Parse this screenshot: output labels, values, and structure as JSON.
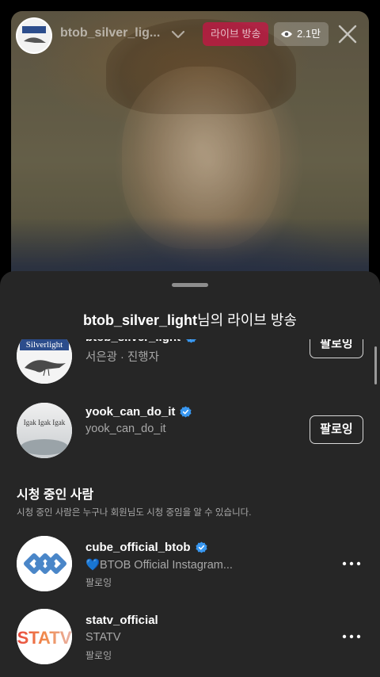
{
  "live": {
    "host_username": "btob_silver_lig...",
    "live_label": "라이브 방송",
    "viewer_count": "2.1만"
  },
  "sheet": {
    "title_bold": "btob_silver_light",
    "title_rest": "님의 라이브 방송",
    "hosts": [
      {
        "username": "btob_silver_light",
        "verified": true,
        "subtitle": "서은광 · 진행자",
        "button_label": "팔로잉",
        "avatar_text": "Silverlight"
      },
      {
        "username": "yook_can_do_it",
        "verified": true,
        "subtitle": "yook_can_do_it",
        "button_label": "팔로잉",
        "avatar_text": "Igak Igak Igak"
      }
    ],
    "viewers_section": {
      "title": "시청 중인 사람",
      "description": "시청 중인 사람은 누구나 회원님도 시청 중임을 알 수 있습니다."
    },
    "viewers": [
      {
        "username": "cube_official_btob",
        "verified": true,
        "subtitle": "💙BTOB Official Instagram...",
        "status": "팔로잉"
      },
      {
        "username": "statv_official",
        "verified": false,
        "subtitle": "STATV",
        "status": "팔로잉",
        "avatar_text": "STATV"
      }
    ]
  },
  "colors": {
    "sheet_bg": "#262626",
    "verified_blue": "#3897f0",
    "live_red": "#c81446",
    "secondary_text": "#a8a8a8"
  }
}
